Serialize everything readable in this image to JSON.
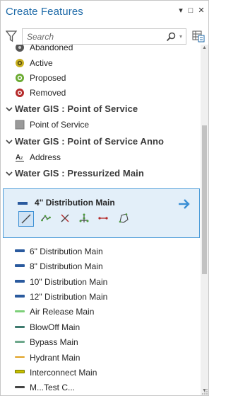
{
  "pane": {
    "title": "Create Features",
    "controls": {
      "menu": "▾",
      "maximize": "□",
      "close": "✕"
    }
  },
  "search": {
    "placeholder": "Search",
    "value": ""
  },
  "groups": [
    {
      "label": "Water GIS : Point of Service"
    },
    {
      "label": "Water GIS : Point of Service Anno"
    },
    {
      "label": "Water GIS : Pressurized Main"
    }
  ],
  "status_items": [
    {
      "label": "Abandoned",
      "color": "#555555"
    },
    {
      "label": "Active",
      "color": "#b8a21a"
    },
    {
      "label": "Proposed",
      "color": "#5a9a2a"
    },
    {
      "label": "Removed",
      "color": "#b52a2a"
    }
  ],
  "pos_item": {
    "label": "Point of Service"
  },
  "anno_item": {
    "label": "Address"
  },
  "selected_template": {
    "label": "4\" Distribution Main",
    "swatch_color": "#2a5a9e",
    "tools": [
      "line-tool",
      "polyline-tool",
      "multipoint-tool",
      "trace-tool",
      "two-point-line-tool",
      "freehand-polygon-tool"
    ]
  },
  "main_items": [
    {
      "label": "6\" Distribution Main",
      "color": "#2a5a9e"
    },
    {
      "label": "8\" Distribution Main",
      "color": "#2a5a9e"
    },
    {
      "label": "10\" Distribution Main",
      "color": "#2a5a9e"
    },
    {
      "label": "12\" Distribution Main",
      "color": "#2a5a9e"
    },
    {
      "label": "Air Release Main",
      "color": "#7ed07a"
    },
    {
      "label": "BlowOff Main",
      "color": "#3e7a6e"
    },
    {
      "label": "Bypass Main",
      "color": "#6ea88c"
    },
    {
      "label": "Hydrant Main",
      "color": "#e0a020"
    },
    {
      "label": "Interconnect Main",
      "color": "#c8c000"
    },
    {
      "label": "M...Test C...",
      "color": "#444444"
    }
  ]
}
